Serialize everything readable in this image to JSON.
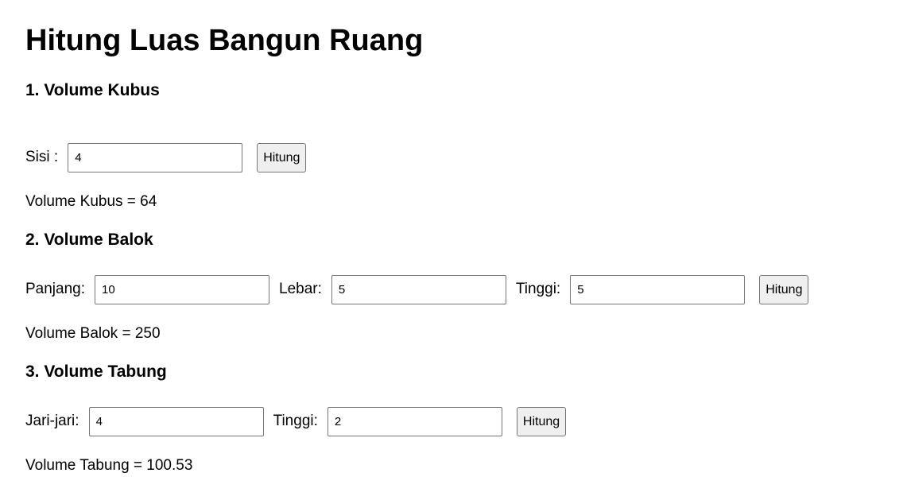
{
  "page": {
    "title": "Hitung Luas Bangun Ruang"
  },
  "kubus": {
    "heading": "1. Volume Kubus",
    "sisi_label": "Sisi :",
    "sisi_value": "4",
    "button_label": "Hitung",
    "result_text": "Volume Kubus = 64"
  },
  "balok": {
    "heading": "2. Volume Balok",
    "panjang_label": "Panjang:",
    "panjang_value": "10",
    "lebar_label": "Lebar:",
    "lebar_value": "5",
    "tinggi_label": "Tinggi:",
    "tinggi_value": "5",
    "button_label": "Hitung",
    "result_text": "Volume Balok = 250"
  },
  "tabung": {
    "heading": "3. Volume Tabung",
    "jari_label": "Jari-jari:",
    "jari_value": "4",
    "tinggi_label": "Tinggi:",
    "tinggi_value": "2",
    "button_label": "Hitung",
    "result_text": "Volume Tabung = 100.53"
  }
}
